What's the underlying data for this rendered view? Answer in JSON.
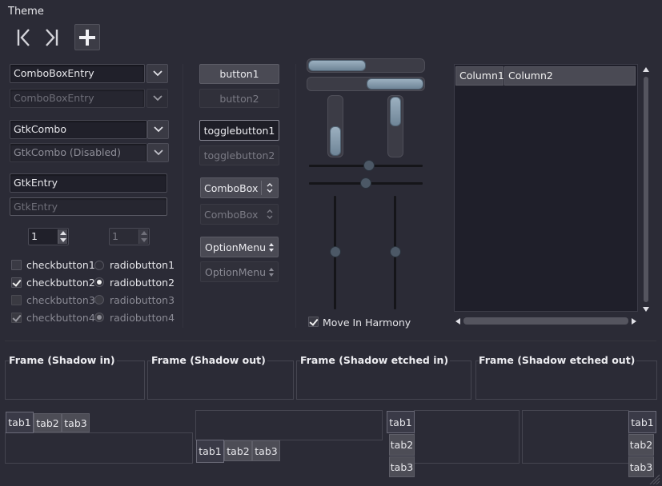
{
  "window": {
    "title": "Theme"
  },
  "toolbar": {
    "icons": [
      "goto-first-icon",
      "goto-last-icon",
      "add-icon"
    ]
  },
  "combos": {
    "entry1": "ComboBoxEntry",
    "entry2": "ComboBoxEntry",
    "gtk1": "GtkCombo",
    "gtk2": "GtkCombo (Disabled)"
  },
  "entries": {
    "entry1": "GtkEntry",
    "entry2": "GtkEntry"
  },
  "spin": {
    "val1": "1",
    "val2": "1"
  },
  "checks": [
    {
      "label": "checkbutton1",
      "checked": false,
      "disabled": false
    },
    {
      "label": "checkbutton2",
      "checked": true,
      "disabled": false
    },
    {
      "label": "checkbutton3",
      "checked": false,
      "disabled": true
    },
    {
      "label": "checkbutton4",
      "checked": true,
      "disabled": true
    }
  ],
  "radios": [
    {
      "label": "radiobutton1",
      "checked": false,
      "disabled": false
    },
    {
      "label": "radiobutton2",
      "checked": true,
      "disabled": false
    },
    {
      "label": "radiobutton3",
      "checked": false,
      "disabled": true
    },
    {
      "label": "radiobutton4",
      "checked": true,
      "disabled": true
    }
  ],
  "buttons": {
    "b1": "button1",
    "b2": "button2",
    "t1": "togglebutton1",
    "t2": "togglebutton2"
  },
  "combobox": {
    "c1": "ComboBox",
    "c2": "ComboBox"
  },
  "optionmenu": {
    "o1": "OptionMenu",
    "o2": "OptionMenu"
  },
  "harmony": {
    "label": "Move In Harmony",
    "checked": true
  },
  "tree": {
    "columns": [
      "Column1",
      "Column2"
    ]
  },
  "frames": [
    "Frame (Shadow in)",
    "Frame (Shadow out)",
    "Frame (Shadow etched in)",
    "Frame (Shadow etched out)"
  ],
  "tabs": [
    "tab1",
    "tab2",
    "tab3"
  ]
}
